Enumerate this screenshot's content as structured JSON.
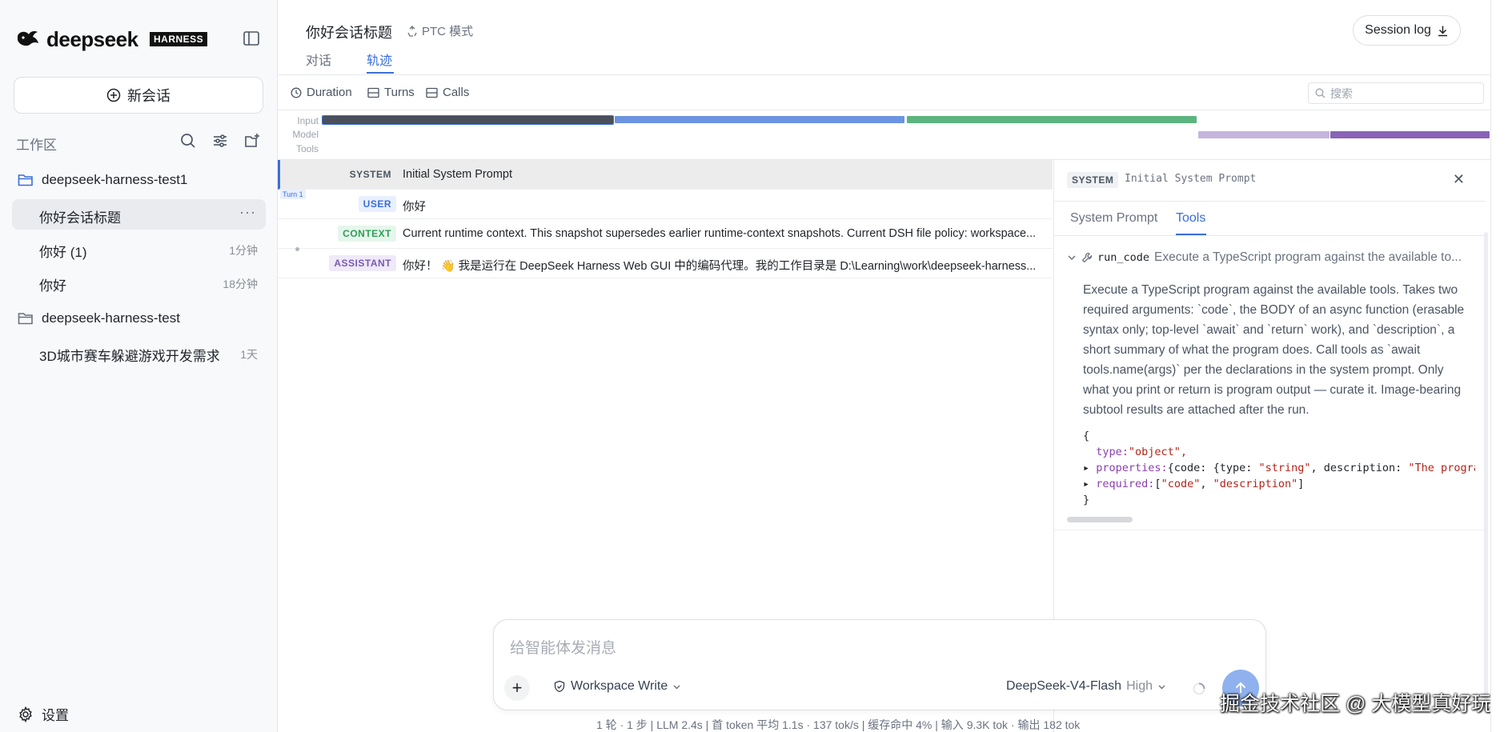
{
  "sidebar": {
    "logo_text": "deepseek",
    "logo_badge": "HARNESS",
    "new_chat_label": "新会话",
    "workspace_title": "工作区",
    "folders": [
      {
        "name": "deepseek-harness-test1",
        "sessions": [
          {
            "label": "你好会话标题",
            "time": "",
            "active": true
          },
          {
            "label": "你好 (1)",
            "time": "1分钟"
          },
          {
            "label": "你好",
            "time": "18分钟"
          }
        ]
      },
      {
        "name": "deepseek-harness-test",
        "sessions": [
          {
            "label": "3D城市赛车躲避游戏开发需求",
            "time": "1天"
          }
        ]
      }
    ],
    "settings_label": "设置"
  },
  "header": {
    "title": "你好会话标题",
    "mode": "PTC 模式",
    "session_log": "Session log",
    "tabs": [
      "对话",
      "轨迹"
    ],
    "active_tab": "轨迹"
  },
  "toolbar": {
    "duration": "Duration",
    "turns": "Turns",
    "calls": "Calls",
    "search_placeholder": "搜索"
  },
  "timeline": {
    "labels": [
      "Input",
      "Model",
      "Tools"
    ],
    "colors": {
      "input": "#4a4f5a",
      "model_blue": "#6b93e0",
      "model_green": "#5cb57e",
      "tools_light": "#c4b5de",
      "tools_dark": "#8a63b7"
    }
  },
  "trace": {
    "turn_tag": "Turn 1",
    "rows": [
      {
        "role": "SYSTEM",
        "text": "Initial System Prompt"
      },
      {
        "role": "USER",
        "text": "你好"
      },
      {
        "role": "CONTEXT",
        "text": "Current runtime context. This snapshot supersedes earlier runtime-context snapshots. Current DSH file policy: workspace..."
      },
      {
        "role": "ASSISTANT",
        "text": "你好！ 👋 我是运行在 DeepSeek Harness Web GUI 中的编码代理。我的工作目录是 D:\\Learning\\work\\deepseek-harness..."
      }
    ]
  },
  "detail": {
    "badge": "SYSTEM",
    "title": "Initial System Prompt",
    "tabs": [
      "System Prompt",
      "Tools"
    ],
    "active_tab": "Tools",
    "tool": {
      "name": "run_code",
      "brief": "Execute a TypeScript program against the available to...",
      "description": "Execute a TypeScript program against the available tools. Takes two required arguments: `code`, the BODY of an async function (erasable syntax only; top-level `await` and `return` work), and `description`, a short summary of what the program does. Call tools as `await tools.name(args)` per the declarations in the system prompt. Only what you print or return is program output — curate it. Image-bearing subtool results are attached after the run.",
      "schema": {
        "open": "{",
        "type_key": "type:",
        "type_val": "\"object\",",
        "properties_key": "properties:",
        "properties_val": "{code: {type: ",
        "properties_type": "\"string\"",
        "properties_desc_key": ", description: ",
        "properties_desc_val": "\"The program",
        "required_key": "required:",
        "required_val_open": "[",
        "required_v1": "\"code\"",
        "required_sep": ", ",
        "required_v2": "\"description\"",
        "required_val_close": "]",
        "close": "}"
      }
    }
  },
  "composer": {
    "placeholder": "给智能体发消息",
    "mode": "Workspace Write",
    "model": "DeepSeek-V4-Flash",
    "effort": "High"
  },
  "status_bar": "1 轮 · 1 步  |  LLM 2.4s  |  首 token 平均 1.1s · 137 tok/s  |  缓存命中 4%  |  输入 9.3K tok · 输出 182 tok",
  "watermark": "掘金技术社区 @ 大模型真好玩"
}
